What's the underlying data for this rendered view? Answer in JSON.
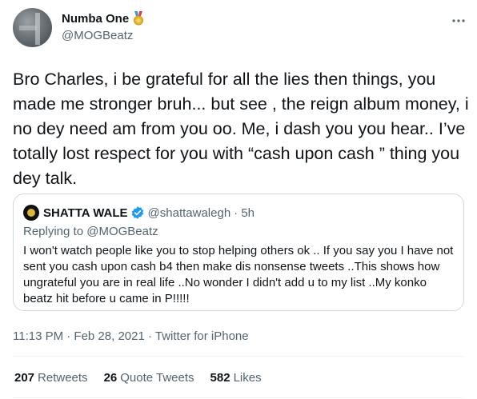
{
  "author": {
    "name": "Numba One",
    "handle": "@MOGBeatz",
    "badge_icon": "medal-icon"
  },
  "tweet": {
    "text": "Bro Charles, i be grateful for all the lies then things, you made me stronger bruh... but see , the reign album money, i no dey need am from you oo. Me,  i dash you you hear.. I’ve totally lost respect for you with  “cash upon cash ” thing you dey talk."
  },
  "quote": {
    "name": "SHATTA WALE",
    "handle": "@shattawalegh",
    "time": "· 5h",
    "replying_prefix": "Replying to ",
    "replying_to": "@MOGBeatz",
    "text": "I won't watch people like you to stop helping others  ok .. If you say you  I have not sent you cash upon cash b4 then make  dis nonsense tweets ..This shows how ungrateful you are in real life ..No wonder I didn't add u to my list ..My konko beatz hit before u came in P!!!!!"
  },
  "meta": {
    "time": "11:13 PM · Feb 28, 2021 · ",
    "source": "Twitter for iPhone"
  },
  "stats": {
    "retweets_count": "207",
    "retweets_label": "Retweets",
    "quotes_count": "26",
    "quotes_label": "Quote Tweets",
    "likes_count": "582",
    "likes_label": "Likes"
  },
  "colors": {
    "text": "#0f1419",
    "secondary": "#536471",
    "verified": "#1d9bf0",
    "border": "#cfd9de"
  }
}
